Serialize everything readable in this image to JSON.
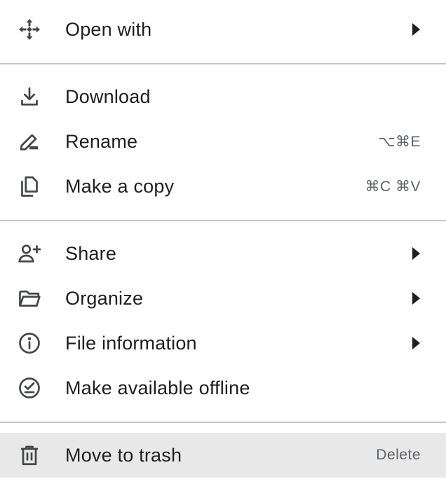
{
  "menu": {
    "items": [
      {
        "label": "Open with",
        "icon": "open-with-icon",
        "submenu": true,
        "shortcut": ""
      },
      {
        "label": "Download",
        "icon": "download-icon",
        "submenu": false,
        "shortcut": ""
      },
      {
        "label": "Rename",
        "icon": "rename-icon",
        "submenu": false,
        "shortcut": "⌥⌘E"
      },
      {
        "label": "Make a copy",
        "icon": "copy-icon",
        "submenu": false,
        "shortcut": "⌘C ⌘V"
      },
      {
        "label": "Share",
        "icon": "share-icon",
        "submenu": true,
        "shortcut": ""
      },
      {
        "label": "Organize",
        "icon": "folder-icon",
        "submenu": true,
        "shortcut": ""
      },
      {
        "label": "File information",
        "icon": "info-icon",
        "submenu": true,
        "shortcut": ""
      },
      {
        "label": "Make available offline",
        "icon": "offline-icon",
        "submenu": false,
        "shortcut": ""
      },
      {
        "label": "Move to trash",
        "icon": "trash-icon",
        "submenu": false,
        "shortcut": "Delete",
        "highlighted": true
      }
    ]
  },
  "colors": {
    "text": "#1f1f1f",
    "shortcut": "#5f6368",
    "divider": "#c4c7c5",
    "highlight": "#e8e8e8",
    "background": "#ffffff"
  }
}
